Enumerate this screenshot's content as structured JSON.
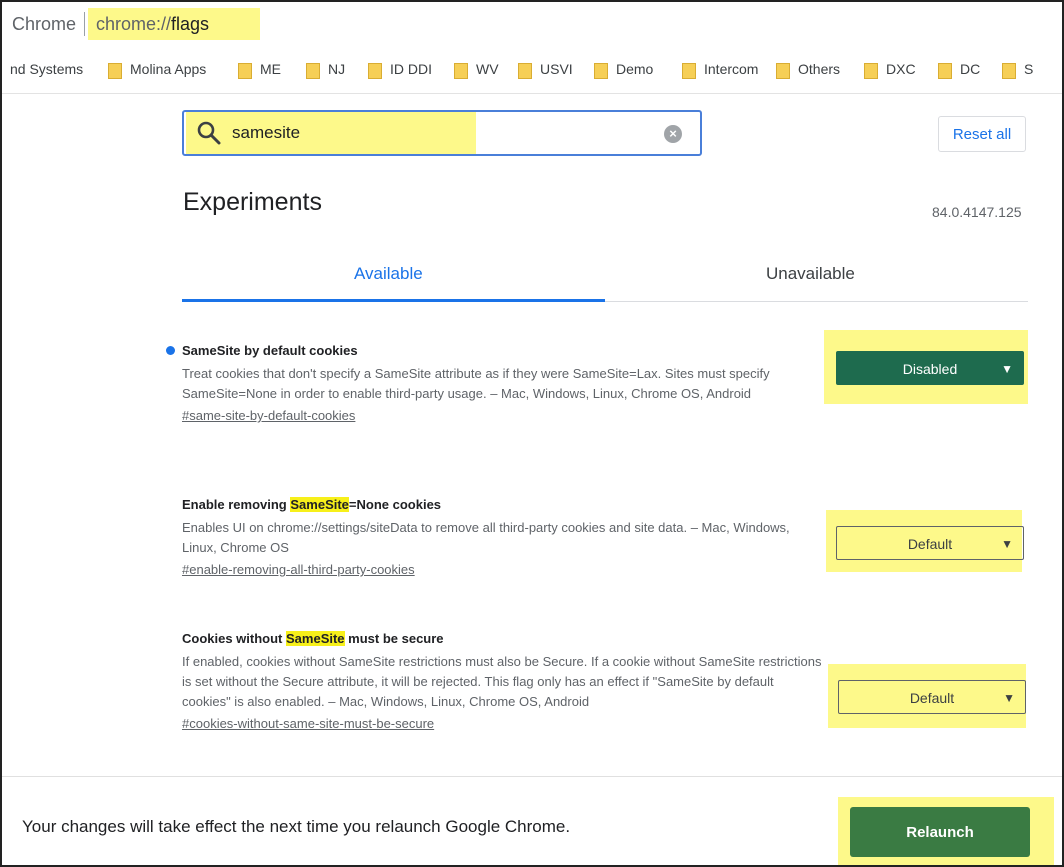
{
  "address_bar": {
    "site_label": "Chrome",
    "url_scheme": "chrome://",
    "url_path": "flags"
  },
  "bookmarks": [
    {
      "label": "nd Systems",
      "folder": false
    },
    {
      "label": "Molina Apps",
      "folder": true
    },
    {
      "label": "ME",
      "folder": true
    },
    {
      "label": "NJ",
      "folder": true
    },
    {
      "label": "ID DDI",
      "folder": true
    },
    {
      "label": "WV",
      "folder": true
    },
    {
      "label": "USVI",
      "folder": true
    },
    {
      "label": "Demo",
      "folder": true
    },
    {
      "label": "Intercom",
      "folder": true
    },
    {
      "label": "Others",
      "folder": true
    },
    {
      "label": "DXC",
      "folder": true
    },
    {
      "label": "DC",
      "folder": true
    },
    {
      "label": "S",
      "folder": true
    }
  ],
  "search": {
    "value": "samesite",
    "reset_label": "Reset all"
  },
  "page": {
    "title": "Experiments",
    "version": "84.0.4147.125"
  },
  "tabs": [
    {
      "label": "Available",
      "active": true
    },
    {
      "label": "Unavailable",
      "active": false
    }
  ],
  "experiments": [
    {
      "title_pre": "SameSite by default cookies",
      "title_hl": "",
      "title_post": "",
      "description": "Treat cookies that don't specify a SameSite attribute as if they were SameSite=Lax. Sites must specify SameSite=None in order to enable third-party usage. – Mac, Windows, Linux, Chrome OS, Android",
      "link": "#same-site-by-default-cookies",
      "selected": "Disabled",
      "modified": true
    },
    {
      "title_pre": "Enable removing ",
      "title_hl": "SameSite",
      "title_post": "=None cookies",
      "description": "Enables UI on chrome://settings/siteData to remove all third-party cookies and site data. – Mac, Windows, Linux, Chrome OS",
      "link": "#enable-removing-all-third-party-cookies",
      "selected": "Default",
      "modified": false
    },
    {
      "title_pre": "Cookies without ",
      "title_hl": "SameSite",
      "title_post": " must be secure",
      "description": "If enabled, cookies without SameSite restrictions must also be Secure. If a cookie without SameSite restrictions is set without the Secure attribute, it will be rejected. This flag only has an effect if \"SameSite by default cookies\" is also enabled. – Mac, Windows, Linux, Chrome OS, Android",
      "link": "#cookies-without-same-site-must-be-secure",
      "selected": "Default",
      "modified": false
    }
  ],
  "footer": {
    "message": "Your changes will take effect the next time you relaunch Google Chrome.",
    "relaunch_label": "Relaunch"
  },
  "colors": {
    "accent": "#1a73e8",
    "highlight": "#fdf98a",
    "disabled_select": "#1e6b4e",
    "relaunch": "#3a7b43"
  }
}
